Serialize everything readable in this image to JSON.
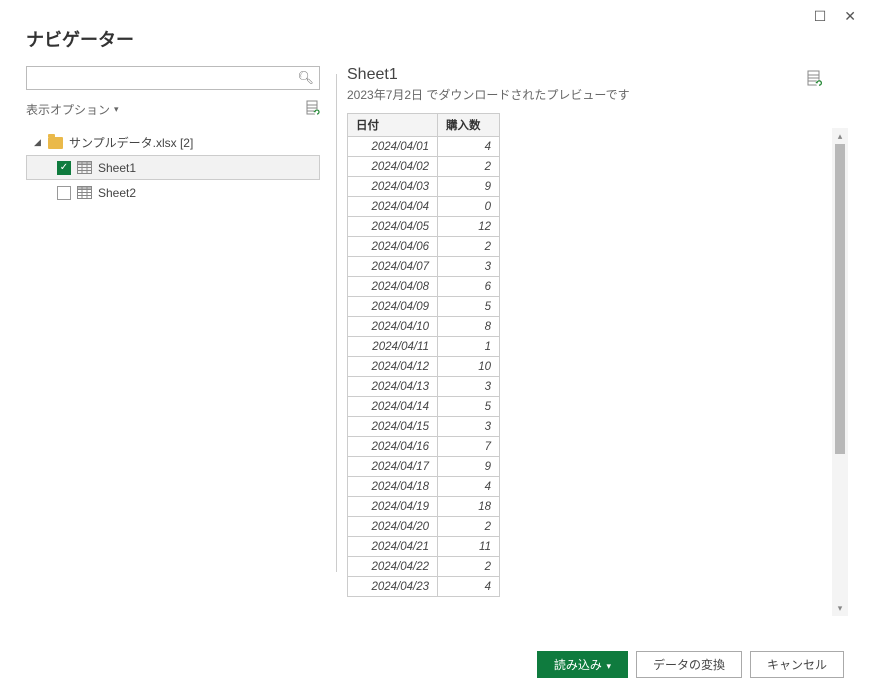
{
  "window": {
    "title": "ナビゲーター"
  },
  "left": {
    "search_placeholder": "",
    "display_options_label": "表示オプション",
    "file_name": "サンプルデータ.xlsx [2]",
    "sheets": [
      {
        "name": "Sheet1",
        "checked": true,
        "selected": true
      },
      {
        "name": "Sheet2",
        "checked": false,
        "selected": false
      }
    ]
  },
  "preview": {
    "title": "Sheet1",
    "subtitle": "2023年7月2日 でダウンロードされたプレビューです",
    "columns": [
      "日付",
      "購入数"
    ],
    "rows": [
      [
        "2024/04/01",
        "4"
      ],
      [
        "2024/04/02",
        "2"
      ],
      [
        "2024/04/03",
        "9"
      ],
      [
        "2024/04/04",
        "0"
      ],
      [
        "2024/04/05",
        "12"
      ],
      [
        "2024/04/06",
        "2"
      ],
      [
        "2024/04/07",
        "3"
      ],
      [
        "2024/04/08",
        "6"
      ],
      [
        "2024/04/09",
        "5"
      ],
      [
        "2024/04/10",
        "8"
      ],
      [
        "2024/04/11",
        "1"
      ],
      [
        "2024/04/12",
        "10"
      ],
      [
        "2024/04/13",
        "3"
      ],
      [
        "2024/04/14",
        "5"
      ],
      [
        "2024/04/15",
        "3"
      ],
      [
        "2024/04/16",
        "7"
      ],
      [
        "2024/04/17",
        "9"
      ],
      [
        "2024/04/18",
        "4"
      ],
      [
        "2024/04/19",
        "18"
      ],
      [
        "2024/04/20",
        "2"
      ],
      [
        "2024/04/21",
        "11"
      ],
      [
        "2024/04/22",
        "2"
      ],
      [
        "2024/04/23",
        "4"
      ]
    ]
  },
  "footer": {
    "load": "読み込み",
    "transform": "データの変換",
    "cancel": "キャンセル"
  }
}
